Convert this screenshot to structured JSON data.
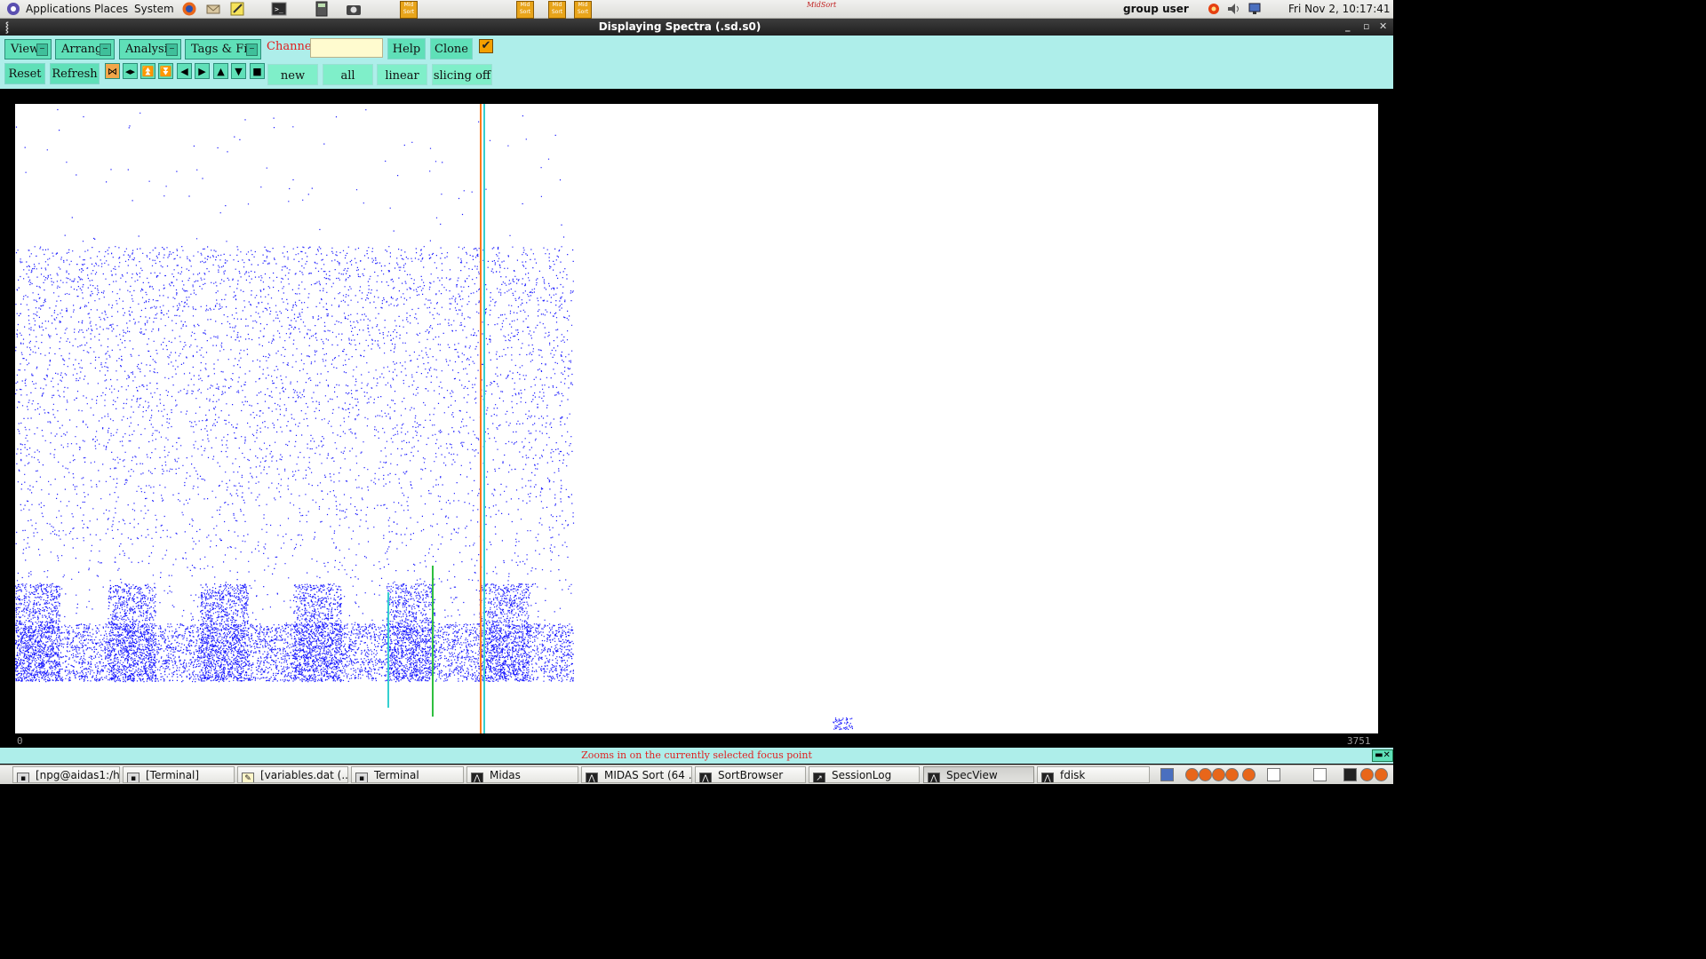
{
  "top_panel": {
    "menus": [
      "Applications",
      "Places",
      "System"
    ],
    "user": "group user",
    "datetime": "Fri Nov  2, 10:17:41",
    "launcher_icons": [
      "firefox-icon",
      "mail-icon",
      "notes-icon",
      "terminal-icon",
      "calculator-icon",
      "camera-icon",
      "midas-icon",
      "midas-icon",
      "midas-icon",
      "midas-icon",
      "midas-sort-logo"
    ],
    "sort_logo_text": "MidSort"
  },
  "window": {
    "title": "Displaying Spectra (.sd.s0)",
    "controls": [
      "_",
      "▫",
      "✕"
    ]
  },
  "toolbar": {
    "menus": [
      {
        "label": "View"
      },
      {
        "label": "Arrange"
      },
      {
        "label": "Analysis"
      },
      {
        "label": "Tags & Fits"
      }
    ],
    "channel_label": "Channel:",
    "channel_value": "",
    "help_label": "Help",
    "clone_label": "Clone",
    "checkbox_checked": true,
    "reset_label": "Reset",
    "refresh_label": "Refresh",
    "nav_icons": [
      "zoom-focus-icon",
      "expand-horizontal-icon",
      "double-up-icon",
      "double-down-icon",
      "left-icon",
      "right-icon",
      "up-icon",
      "down-icon",
      "stop-icon"
    ],
    "toggles": [
      "new",
      "all",
      "linear",
      "slicing off"
    ]
  },
  "plot": {
    "x_min_label": "0",
    "x_max_label": "3751",
    "background": "#ffffff",
    "point_color": "#1a1aff",
    "marker_colors": [
      "#ff7a1a",
      "#35d0d0",
      "#2fbf40"
    ]
  },
  "status": {
    "message": "Zooms in on the currently selected focus point"
  },
  "taskbar": {
    "tasks": [
      {
        "label": "[npg@aidas1:/h...",
        "icon": "terminal-icon",
        "active": false
      },
      {
        "label": "[Terminal]",
        "icon": "terminal-icon",
        "active": false
      },
      {
        "label": "[variables.dat (...",
        "icon": "text-editor-icon",
        "active": false
      },
      {
        "label": "Terminal",
        "icon": "terminal-icon",
        "active": false
      },
      {
        "label": "Midas",
        "icon": "midas-app-icon",
        "active": false
      },
      {
        "label": "MIDAS Sort (64 ...",
        "icon": "midas-app-icon",
        "active": false
      },
      {
        "label": "SortBrowser",
        "icon": "midas-app-icon",
        "active": false
      },
      {
        "label": "SessionLog",
        "icon": "session-log-icon",
        "active": false
      },
      {
        "label": "SpecView",
        "icon": "midas-app-icon",
        "active": true
      },
      {
        "label": "fdisk",
        "icon": "midas-app-icon",
        "active": false
      }
    ]
  }
}
